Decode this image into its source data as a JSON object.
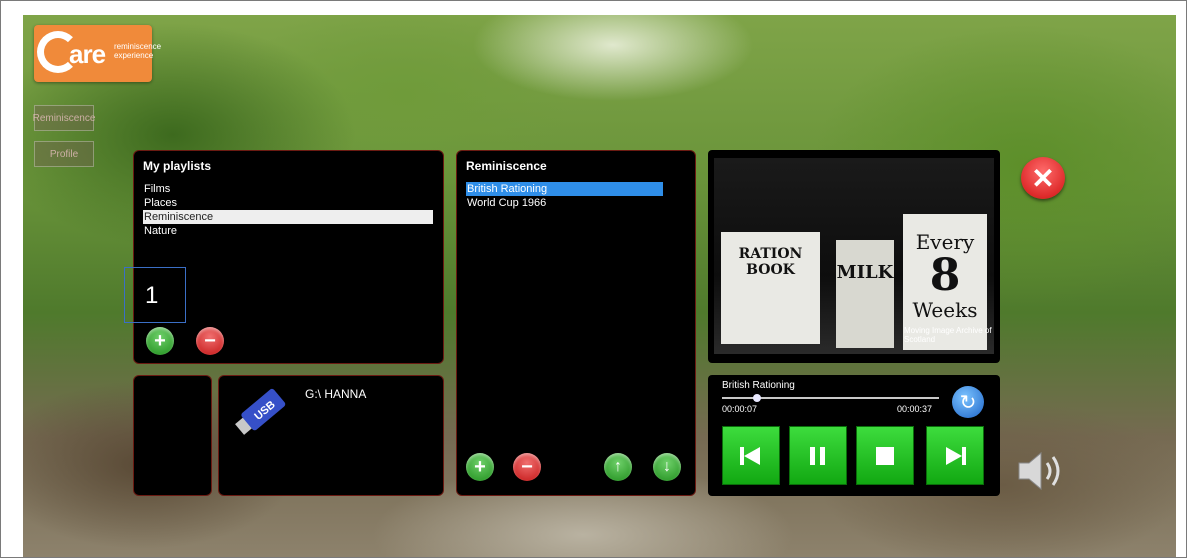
{
  "logo": {
    "main": "are",
    "tagline_1": "reminiscence",
    "tagline_2": "experience"
  },
  "side_buttons": {
    "top": "Reminiscence",
    "bottom": "Profile"
  },
  "playlists": {
    "title": "My playlists",
    "items": [
      "Films",
      "Places",
      "Reminiscence",
      "Nature"
    ],
    "selected_index": 2
  },
  "annotation": {
    "label": "1"
  },
  "device": {
    "name": "G:\\ HANNA",
    "icon_text": "USB"
  },
  "reminiscence": {
    "title": "Reminiscence",
    "items": [
      "British Rationing",
      "World Cup 1966"
    ],
    "selected_index": 0
  },
  "photo": {
    "card_1": "RATION BOOK",
    "card_2": "MILK",
    "card_3_top": "Every",
    "card_3_num": "8",
    "card_3_bottom": "Weeks",
    "watermark": "Moving Image Archive of Scotland"
  },
  "player": {
    "track": "British Rationing",
    "elapsed": "00:00:07",
    "total": "00:00:37",
    "progress": 0.16
  },
  "icons": {
    "add": "plus-icon",
    "remove": "minus-icon",
    "up": "arrow-up-icon",
    "down": "arrow-down-icon",
    "close": "close-icon",
    "volume": "speaker-icon",
    "refresh": "refresh-icon"
  }
}
